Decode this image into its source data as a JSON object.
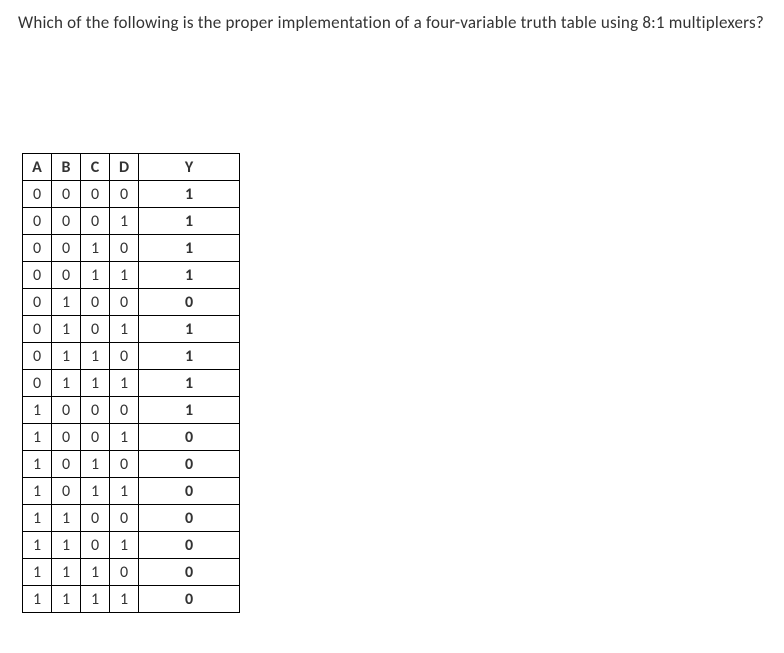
{
  "question": "Which of the following is the proper implementation of a four-variable truth table using 8:1 multiplexers?",
  "table": {
    "headers": [
      "A",
      "B",
      "C",
      "D",
      "Y"
    ],
    "rows": [
      {
        "A": "0",
        "B": "0",
        "C": "0",
        "D": "0",
        "Y": "1"
      },
      {
        "A": "0",
        "B": "0",
        "C": "0",
        "D": "1",
        "Y": "1"
      },
      {
        "A": "0",
        "B": "0",
        "C": "1",
        "D": "0",
        "Y": "1"
      },
      {
        "A": "0",
        "B": "0",
        "C": "1",
        "D": "1",
        "Y": "1"
      },
      {
        "A": "0",
        "B": "1",
        "C": "0",
        "D": "0",
        "Y": "0"
      },
      {
        "A": "0",
        "B": "1",
        "C": "0",
        "D": "1",
        "Y": "1"
      },
      {
        "A": "0",
        "B": "1",
        "C": "1",
        "D": "0",
        "Y": "1"
      },
      {
        "A": "0",
        "B": "1",
        "C": "1",
        "D": "1",
        "Y": "1"
      },
      {
        "A": "1",
        "B": "0",
        "C": "0",
        "D": "0",
        "Y": "1"
      },
      {
        "A": "1",
        "B": "0",
        "C": "0",
        "D": "1",
        "Y": "0"
      },
      {
        "A": "1",
        "B": "0",
        "C": "1",
        "D": "0",
        "Y": "0"
      },
      {
        "A": "1",
        "B": "0",
        "C": "1",
        "D": "1",
        "Y": "0"
      },
      {
        "A": "1",
        "B": "1",
        "C": "0",
        "D": "0",
        "Y": "0"
      },
      {
        "A": "1",
        "B": "1",
        "C": "0",
        "D": "1",
        "Y": "0"
      },
      {
        "A": "1",
        "B": "1",
        "C": "1",
        "D": "0",
        "Y": "0"
      },
      {
        "A": "1",
        "B": "1",
        "C": "1",
        "D": "1",
        "Y": "0"
      }
    ]
  },
  "chart_data": {
    "type": "table",
    "title": "Four-variable truth table",
    "columns": [
      "A",
      "B",
      "C",
      "D",
      "Y"
    ],
    "data": [
      [
        0,
        0,
        0,
        0,
        1
      ],
      [
        0,
        0,
        0,
        1,
        1
      ],
      [
        0,
        0,
        1,
        0,
        1
      ],
      [
        0,
        0,
        1,
        1,
        1
      ],
      [
        0,
        1,
        0,
        0,
        0
      ],
      [
        0,
        1,
        0,
        1,
        1
      ],
      [
        0,
        1,
        1,
        0,
        1
      ],
      [
        0,
        1,
        1,
        1,
        1
      ],
      [
        1,
        0,
        0,
        0,
        1
      ],
      [
        1,
        0,
        0,
        1,
        0
      ],
      [
        1,
        0,
        1,
        0,
        0
      ],
      [
        1,
        0,
        1,
        1,
        0
      ],
      [
        1,
        1,
        0,
        0,
        0
      ],
      [
        1,
        1,
        0,
        1,
        0
      ],
      [
        1,
        1,
        1,
        0,
        0
      ],
      [
        1,
        1,
        1,
        1,
        0
      ]
    ]
  }
}
